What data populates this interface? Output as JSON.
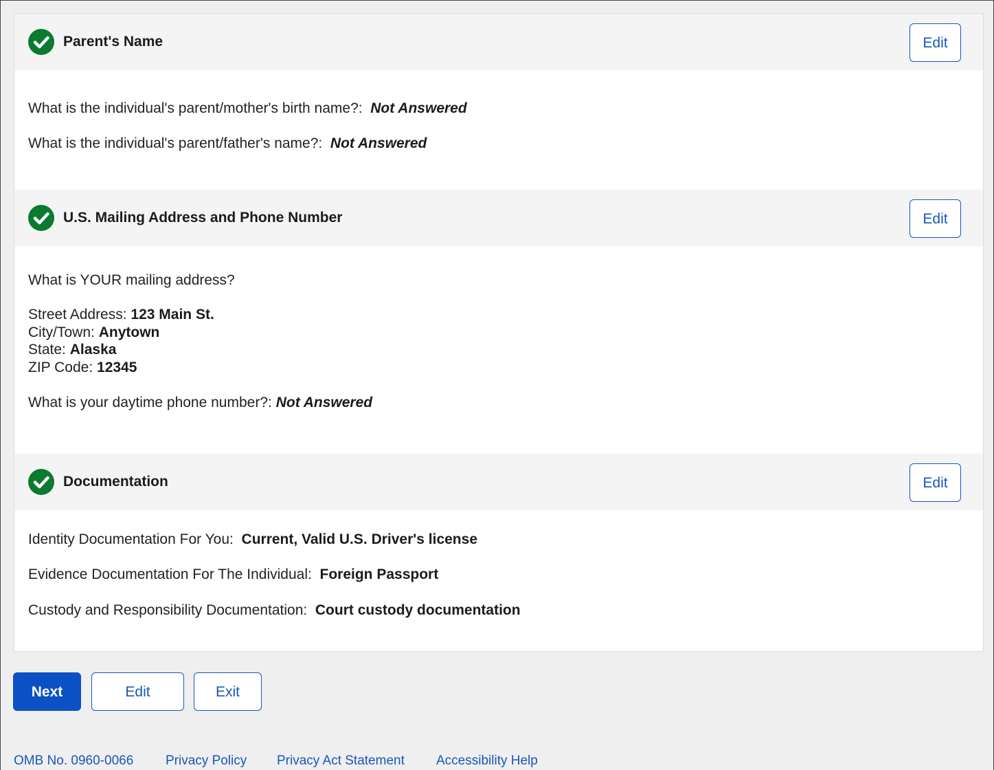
{
  "sections": [
    {
      "title": "Parent's Name",
      "edit_label": "Edit",
      "lines": [
        {
          "label": "What is the individual's parent/mother's birth name?:",
          "value": "Not Answered"
        },
        {
          "label": "What is the individual's parent/father's name?:",
          "value": "Not Answered"
        }
      ]
    },
    {
      "title": "U.S. Mailing Address and Phone Number",
      "edit_label": "Edit",
      "question": "What is YOUR mailing address?",
      "address": [
        {
          "label": "Street Address:",
          "value": "123 Main St."
        },
        {
          "label": "City/Town:",
          "value": "Anytown"
        },
        {
          "label": "State:",
          "value": "Alaska"
        },
        {
          "label": "ZIP Code:",
          "value": "12345"
        }
      ],
      "phone": {
        "label": "What is your daytime phone number?:",
        "value": "Not Answered"
      }
    },
    {
      "title": "Documentation",
      "edit_label": "Edit",
      "lines": [
        {
          "label": "Identity Documentation For You:",
          "value": "Current, Valid U.S. Driver's license"
        },
        {
          "label": "Evidence Documentation For The Individual:",
          "value": "Foreign Passport"
        },
        {
          "label": "Custody and Responsibility Documentation:",
          "value": "Court custody documentation"
        }
      ]
    }
  ],
  "actions": {
    "next_label": "Next",
    "edit_label": "Edit",
    "exit_label": "Exit"
  },
  "footer": {
    "omb": "OMB No. 0960-0066",
    "privacy_policy": "Privacy Policy",
    "privacy_act": "Privacy Act Statement",
    "accessibility": "Accessibility Help"
  },
  "colors": {
    "check_green": "#0b7a2e",
    "primary_blue": "#0b51c5",
    "link_blue": "#1a56b8"
  }
}
